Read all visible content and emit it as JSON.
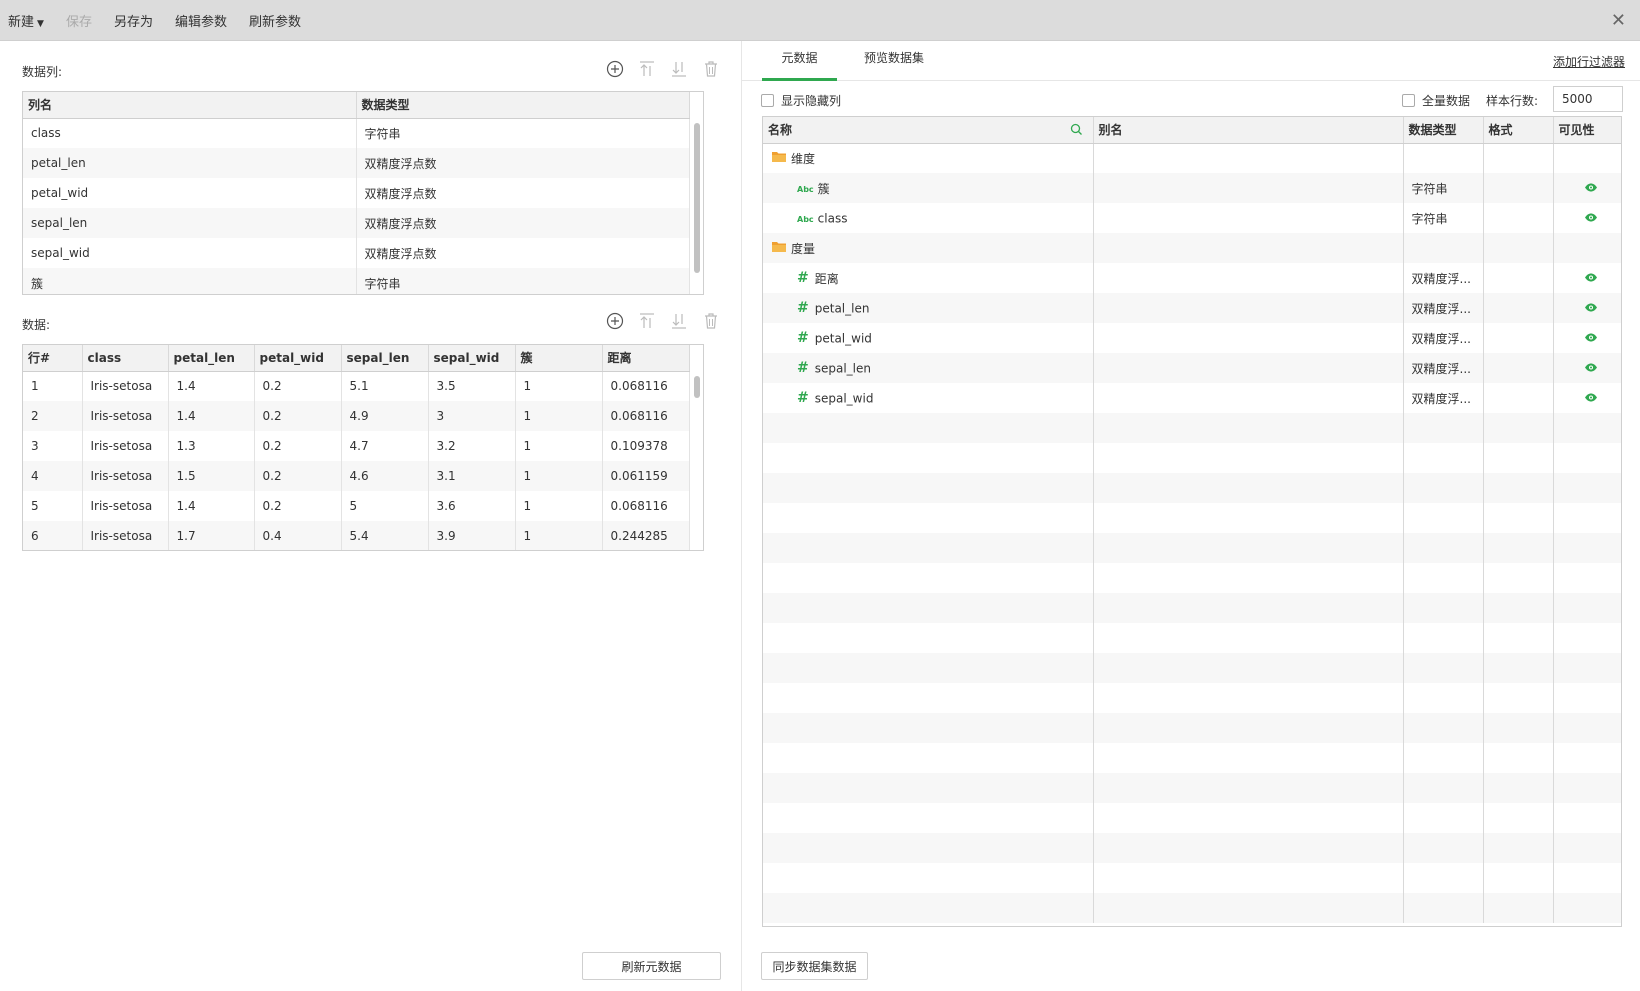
{
  "toolbar": {
    "new_label": "新建",
    "save_label": "保存",
    "save_as_label": "另存为",
    "edit_params_label": "编辑参数",
    "refresh_params_label": "刷新参数"
  },
  "left": {
    "columns_label": "数据列:",
    "columns_headers": [
      "列名",
      "数据类型"
    ],
    "columns_rows": [
      [
        "class",
        "字符串"
      ],
      [
        "petal_len",
        "双精度浮点数"
      ],
      [
        "petal_wid",
        "双精度浮点数"
      ],
      [
        "sepal_len",
        "双精度浮点数"
      ],
      [
        "sepal_wid",
        "双精度浮点数"
      ],
      [
        "簇",
        "字符串"
      ]
    ],
    "data_label": "数据:",
    "data_headers": [
      "行#",
      "class",
      "petal_len",
      "petal_wid",
      "sepal_len",
      "sepal_wid",
      "簇",
      "距离"
    ],
    "data_rows": [
      [
        "1",
        "Iris-setosa",
        "1.4",
        "0.2",
        "5.1",
        "3.5",
        "1",
        "0.068116"
      ],
      [
        "2",
        "Iris-setosa",
        "1.4",
        "0.2",
        "4.9",
        "3",
        "1",
        "0.068116"
      ],
      [
        "3",
        "Iris-setosa",
        "1.3",
        "0.2",
        "4.7",
        "3.2",
        "1",
        "0.109378"
      ],
      [
        "4",
        "Iris-setosa",
        "1.5",
        "0.2",
        "4.6",
        "3.1",
        "1",
        "0.061159"
      ],
      [
        "5",
        "Iris-setosa",
        "1.4",
        "0.2",
        "5",
        "3.6",
        "1",
        "0.068116"
      ],
      [
        "6",
        "Iris-setosa",
        "1.7",
        "0.4",
        "5.4",
        "3.9",
        "1",
        "0.244285"
      ]
    ],
    "refresh_meta_label": "刷新元数据"
  },
  "right": {
    "tab_meta": "元数据",
    "tab_preview": "预览数据集",
    "add_filter_label": "添加行过滤器",
    "show_hidden_label": "显示隐藏列",
    "full_data_label": "全量数据",
    "sample_rows_label": "样本行数:",
    "sample_rows_value": "5000",
    "meta_headers": [
      "名称",
      "别名",
      "数据类型",
      "格式",
      "可见性"
    ],
    "meta_rows": [
      {
        "kind": "folder",
        "name": "维度",
        "type": ""
      },
      {
        "kind": "abc",
        "name": "簇",
        "type": "字符串"
      },
      {
        "kind": "abc",
        "name": "class",
        "type": "字符串"
      },
      {
        "kind": "folder",
        "name": "度量",
        "type": ""
      },
      {
        "kind": "num",
        "name": "距离",
        "type": "双精度浮..."
      },
      {
        "kind": "num",
        "name": "petal_len",
        "type": "双精度浮..."
      },
      {
        "kind": "num",
        "name": "petal_wid",
        "type": "双精度浮..."
      },
      {
        "kind": "num",
        "name": "sepal_len",
        "type": "双精度浮..."
      },
      {
        "kind": "num",
        "name": "sepal_wid",
        "type": "双精度浮..."
      }
    ],
    "abc_badge": "Abc",
    "hash_glyph": "#",
    "sync_label": "同步数据集数据"
  },
  "colors": {
    "accent_green": "#2fa84f",
    "folder_orange": "#f0a030"
  }
}
